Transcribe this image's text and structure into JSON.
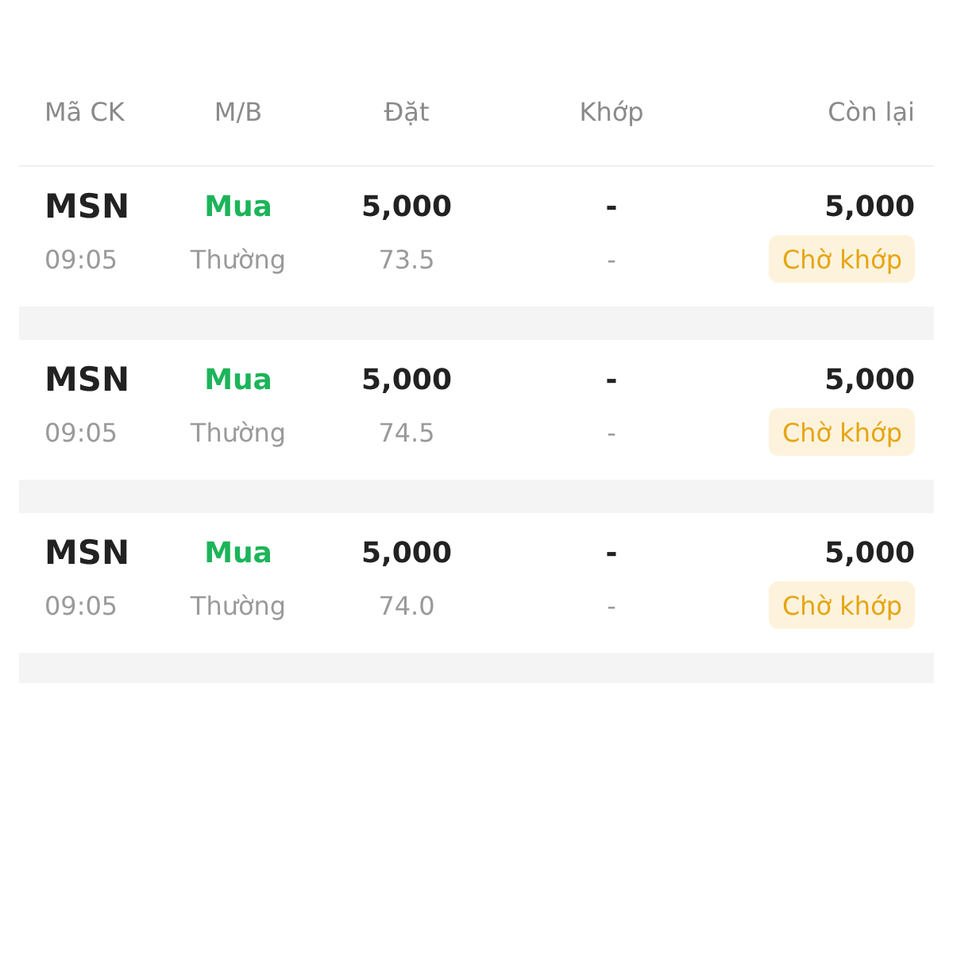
{
  "columns": [
    "Mã CK",
    "M/B",
    "Đặt",
    "Khớp",
    "Còn lại"
  ],
  "orders": [
    {
      "symbol": "MSN",
      "time": "09:05",
      "side": "Mua",
      "order_type": "Thường",
      "quantity": "5,000",
      "price": "73.5",
      "matched": "-",
      "matched_price": "-",
      "remaining": "5,000",
      "status": "Chờ khớp"
    },
    {
      "symbol": "MSN",
      "time": "09:05",
      "side": "Mua",
      "order_type": "Thường",
      "quantity": "5,000",
      "price": "74.5",
      "matched": "-",
      "matched_price": "-",
      "remaining": "5,000",
      "status": "Chờ khớp"
    },
    {
      "symbol": "MSN",
      "time": "09:05",
      "side": "Mua",
      "order_type": "Thường",
      "quantity": "5,000",
      "price": "74.0",
      "matched": "-",
      "matched_price": "-",
      "remaining": "5,000",
      "status": "Chờ khớp"
    }
  ]
}
